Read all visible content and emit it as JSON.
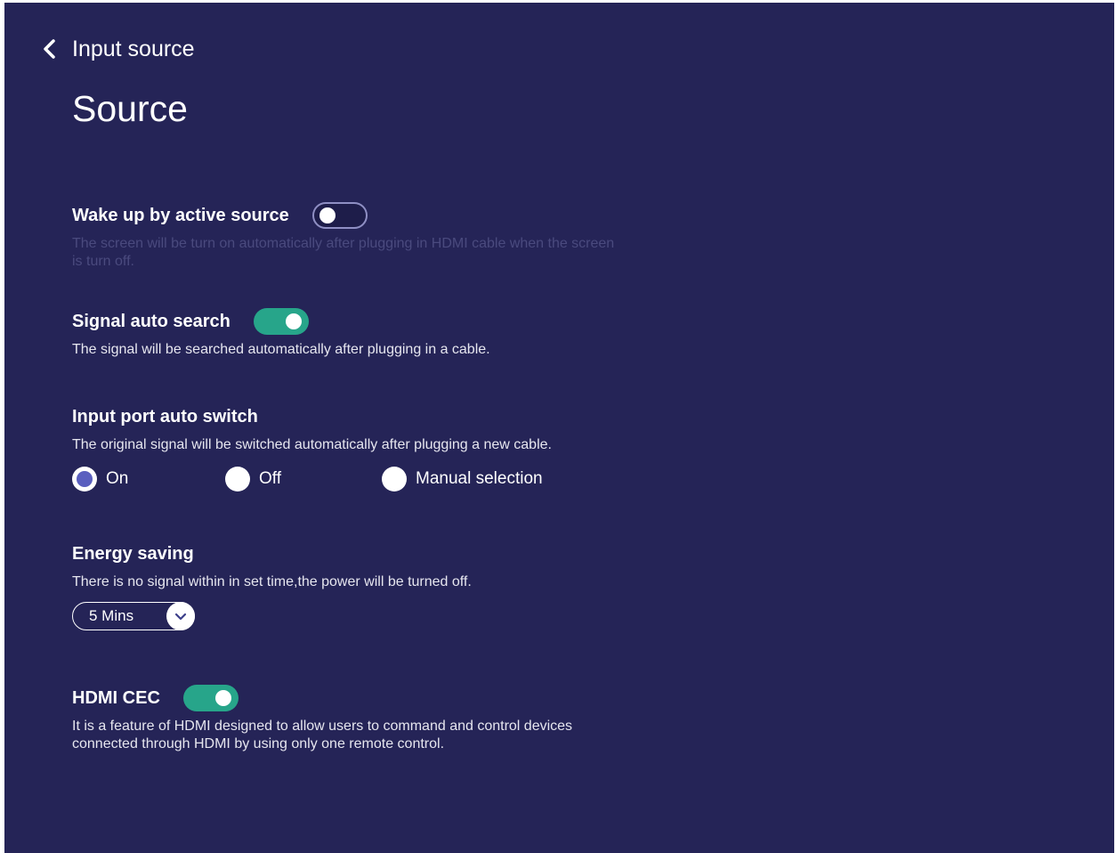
{
  "header": {
    "back_label": "Input source",
    "page_title": "Source"
  },
  "colors": {
    "background": "#252457",
    "toggle_on": "#27a58a",
    "radio_selected": "#5a5fbf"
  },
  "settings": {
    "wake_up": {
      "label": "Wake up by active source",
      "description": "The screen will be turn on automatically after plugging in HDMI cable when the screen is turn off.",
      "enabled": false
    },
    "signal_auto_search": {
      "label": "Signal auto search",
      "description": "The signal will be searched automatically after plugging in a cable.",
      "enabled": true
    },
    "input_port_auto_switch": {
      "label": "Input port auto switch",
      "description": "The original signal will be switched automatically after plugging a new cable.",
      "options": [
        "On",
        "Off",
        "Manual selection"
      ],
      "selected": "On"
    },
    "energy_saving": {
      "label": "Energy saving",
      "description": "There is no signal within in set time,the power will be turned off.",
      "value": "5 Mins"
    },
    "hdmi_cec": {
      "label": "HDMI CEC",
      "description": "It is a feature of HDMI designed to allow users to command and control devices connected through HDMI by using only one remote control.",
      "enabled": true
    }
  }
}
